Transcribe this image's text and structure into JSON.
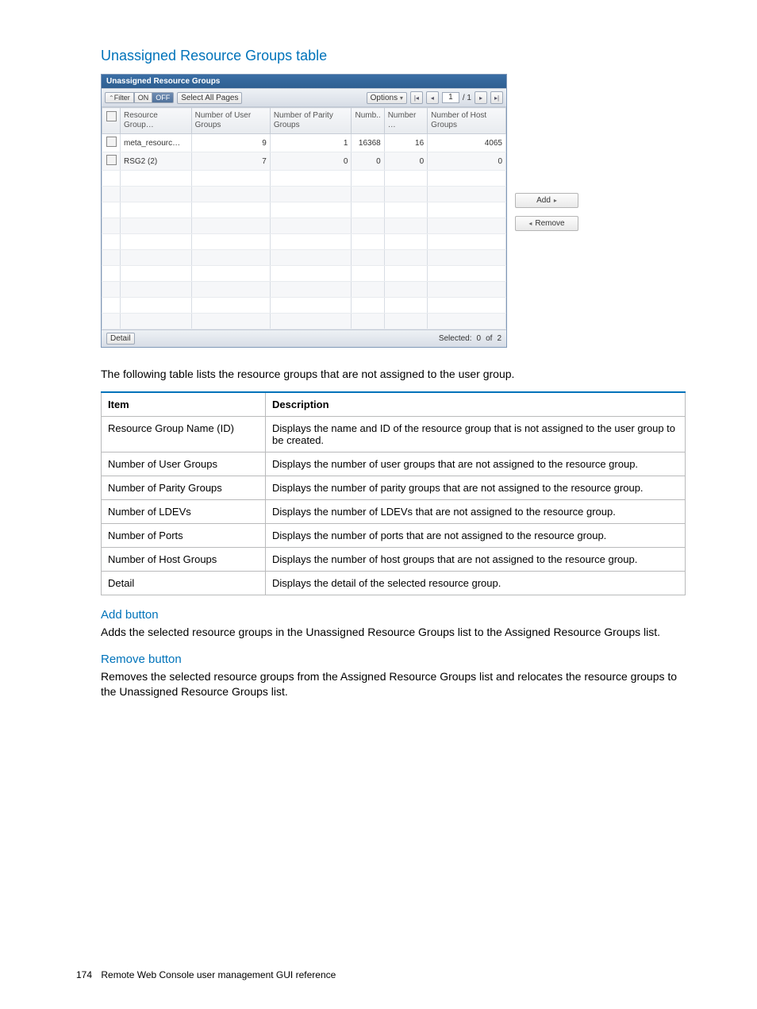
{
  "title": "Unassigned Resource Groups table",
  "panel": {
    "heading": "Unassigned Resource Groups",
    "toolbar": {
      "filter_label": "Filter",
      "on": "ON",
      "off": "OFF",
      "select_all": "Select All Pages",
      "options": "Options",
      "page_current": "1",
      "page_total": "/ 1"
    },
    "headers": {
      "resource_group": "Resource Group…",
      "num_user_groups": "Number of User Groups",
      "num_parity_groups": "Number of Parity Groups",
      "num_ldevs": "Numb..",
      "num_ports": "Number …",
      "num_host_groups": "Number of Host Groups"
    },
    "rows": [
      {
        "name": "meta_resourc…",
        "ug": "9",
        "pg": "1",
        "ld": "16368",
        "po": "16",
        "hg": "4065"
      },
      {
        "name": "RSG2 (2)",
        "ug": "7",
        "pg": "0",
        "ld": "0",
        "po": "0",
        "hg": "0"
      }
    ],
    "footer": {
      "detail": "Detail",
      "selected_label": "Selected:",
      "selected_count": "0",
      "of_label": "of",
      "total": "2"
    }
  },
  "side": {
    "add": "Add",
    "remove": "Remove"
  },
  "intro": "The following table lists the resource groups that are not assigned to the user group.",
  "desc_head": {
    "item": "Item",
    "desc": "Description"
  },
  "desc_rows": [
    {
      "item": "Resource Group Name (ID)",
      "desc": "Displays the name and ID of the resource group that is not assigned to the user group to be created."
    },
    {
      "item": "Number of User Groups",
      "desc": "Displays the number of user groups that are not assigned to the resource group."
    },
    {
      "item": "Number of Parity Groups",
      "desc": "Displays the number of parity groups that are not assigned to the resource group."
    },
    {
      "item": "Number of LDEVs",
      "desc": "Displays the number of LDEVs that are not assigned to the resource group."
    },
    {
      "item": "Number of Ports",
      "desc": "Displays the number of ports that are not assigned to the resource group."
    },
    {
      "item": "Number of Host Groups",
      "desc": "Displays the number of host groups that are not assigned to the resource group."
    },
    {
      "item": "Detail",
      "desc": "Displays the detail of the selected resource group."
    }
  ],
  "add_h": "Add button",
  "add_p": "Adds the selected resource groups in the Unassigned Resource Groups list to the Assigned Resource Groups list.",
  "remove_h": "Remove button",
  "remove_p": "Removes the selected resource groups from the Assigned Resource Groups list and relocates the resource groups to the Unassigned Resource Groups list.",
  "footer": {
    "num": "174",
    "text": "Remote Web Console user management GUI reference"
  }
}
